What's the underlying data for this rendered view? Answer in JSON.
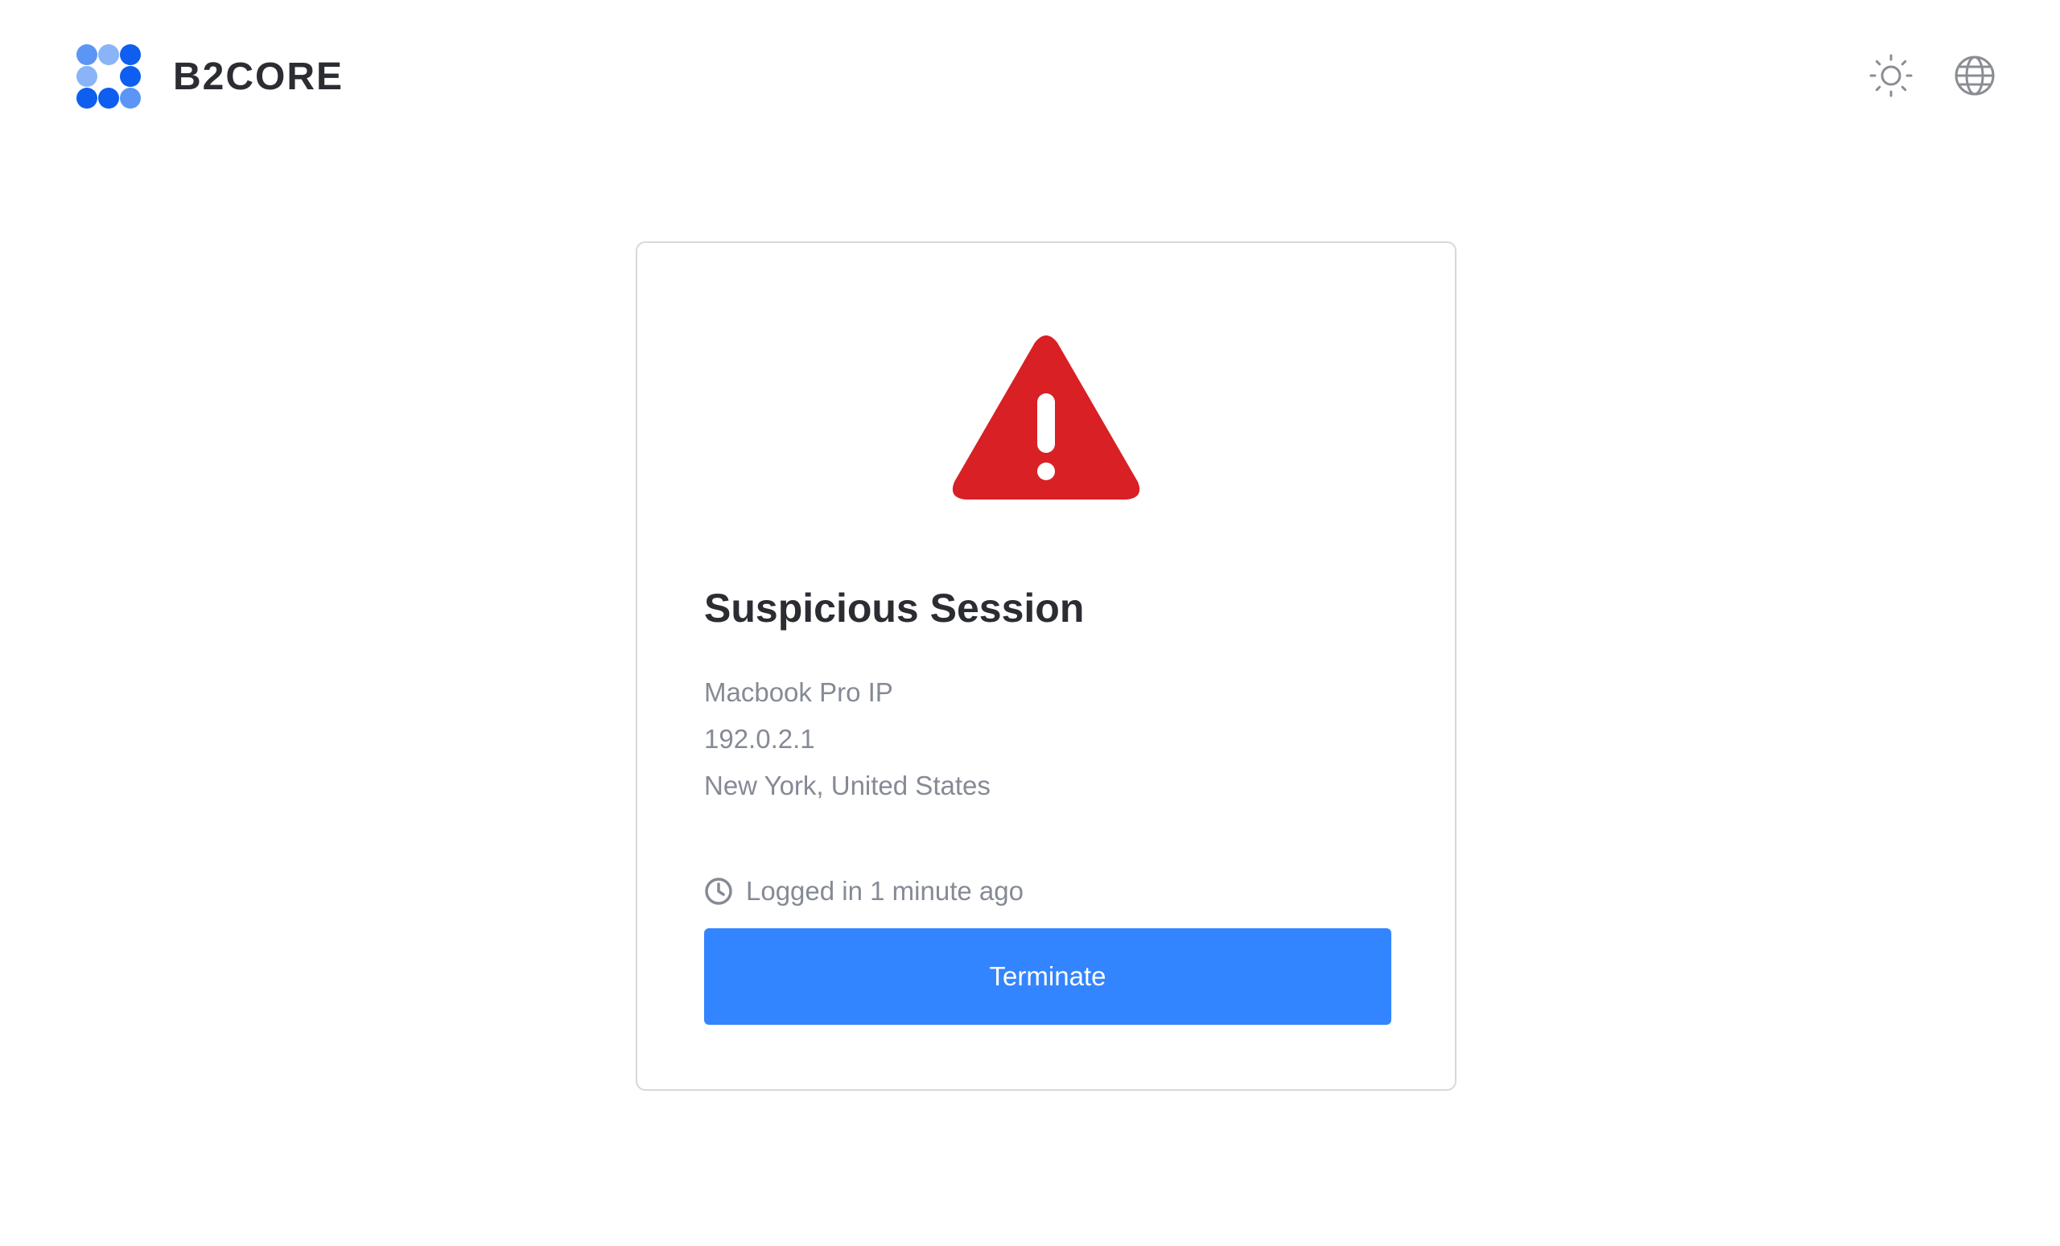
{
  "header": {
    "brand": "B2CORE",
    "logo_colors": {
      "primary": "#0e5ef0",
      "secondary": "#5b96f5",
      "light": "#8ab4f8"
    },
    "icons": [
      "sun-icon",
      "globe-icon"
    ]
  },
  "card": {
    "icon": "warning-triangle-icon",
    "title": "Suspicious Session",
    "device": "Macbook Pro IP",
    "ip": "192.0.2.1",
    "location": "New York, United States",
    "logged_in": "Logged in 1 minute ago",
    "terminate_label": "Terminate"
  },
  "colors": {
    "accent": "#3385ff",
    "danger": "#d82025",
    "text_primary": "#2b2d33",
    "text_secondary": "#858a95"
  }
}
